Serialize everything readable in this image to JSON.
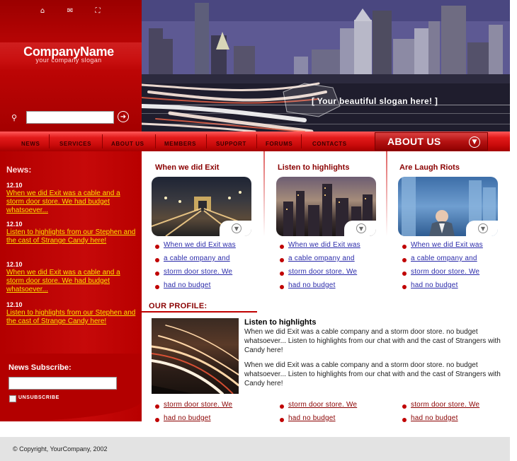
{
  "header": {
    "company_name": "CompanyName",
    "slogan": "your company slogan",
    "photo_slogan": "[ Your beautiful slogan here! ]",
    "search_placeholder": ""
  },
  "nav": {
    "items": [
      "NEWS",
      "SERVICES",
      "ABOUT US",
      "MEMBERS",
      "SUPPORT",
      "FORUMS",
      "CONTACTS"
    ],
    "active_section": "ABOUT US"
  },
  "sidebar": {
    "news_title": "News:",
    "news": [
      {
        "date": "12.10",
        "text": "When we did Exit was a cable and a storm door store. We had budget whatsoever..."
      },
      {
        "date": "12.10",
        "text": "Listen to highlights from our Stephen and the cast of Strange Candy here!"
      },
      {
        "date": "12.10",
        "text": "When we did Exit was a cable and a storm door store. We had budget whatsoever..."
      },
      {
        "date": "12.10",
        "text": "Listen to highlights from our Stephen and the cast of Strange Candy here!"
      }
    ],
    "subscribe_title": "News Subscribe:",
    "unsubscribe_label": "UNSUBSCRIBE"
  },
  "columns": [
    {
      "title": "When we did Exit",
      "links": [
        "When we did Exit was",
        "a cable ompany and",
        "storm door store. We",
        "had no budget"
      ]
    },
    {
      "title": "Listen to highlights",
      "links": [
        "When we did Exit was",
        "a cable ompany and",
        "storm door store. We",
        "had no budget"
      ]
    },
    {
      "title": "Are Laugh Riots",
      "links": [
        "When we did Exit was",
        "a cable ompany and",
        "storm door store. We",
        "had no budget"
      ]
    }
  ],
  "profile": {
    "title": "OUR PROFILE:",
    "heading": "Listen to highlights",
    "paragraph1": "When we did Exit was a cable company and a storm door store. no budget whatsoever... Listen to highlights from our chat with and the cast of Strangers with Candy here!",
    "paragraph2": "When we did Exit was a cable company and a storm door store. no budget whatsoever... Listen to highlights from our chat with and the cast of Strangers with Candy here!"
  },
  "bottom_links": [
    [
      "storm door store. We",
      "had no budget"
    ],
    [
      "storm door store. We",
      "had no budget"
    ],
    [
      "storm door store. We",
      "had no budget"
    ]
  ],
  "footer": {
    "copyright": "© Copyright, YourCompany, 2002"
  },
  "icons": {
    "top": [
      "home-icon",
      "mail-icon",
      "sitemap-icon"
    ],
    "search": "key-icon",
    "go": "arrow-right-circle-icon",
    "more": "arrow-down-circle-icon"
  },
  "colors": {
    "brand_red": "#c10606",
    "link_blue": "#2b2baa",
    "link_dark_red": "#8a0000",
    "news_link_yellow": "#ffe000"
  }
}
